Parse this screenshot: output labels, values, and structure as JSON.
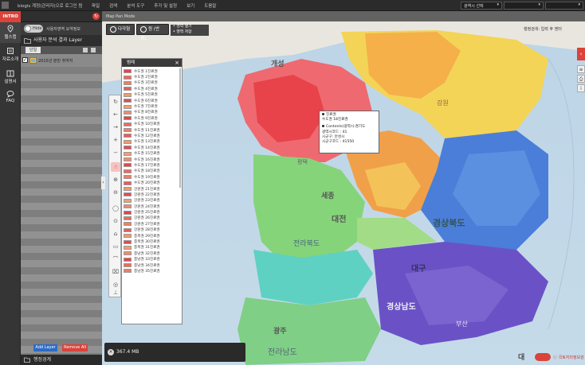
{
  "topbar": {
    "login_text": "biogis 계정(관리자)으로 로그인 됨",
    "menu": [
      "파일",
      "검색",
      "분석 도구",
      "추가 및 설정",
      "보기",
      "도움말"
    ],
    "region_select": "광역시 선택",
    "select2": "",
    "select3": ""
  },
  "intro_label": "INTRO",
  "refresh_glyph": "↻",
  "nav": [
    {
      "label": "웹스맵",
      "icon": "map-pin-icon"
    },
    {
      "label": "자료소개",
      "icon": "book-icon"
    },
    {
      "label": "설명서",
      "icon": "manual-icon"
    },
    {
      "label": "FAQ",
      "icon": "speech-bubble-icon"
    }
  ],
  "panel": {
    "toggle_label": "Hide",
    "hint": "사용자영역 요약정보",
    "layer_title": "사용자 분석 결과 Layer",
    "tab_single": "단일",
    "layer_name": "2015년 분만 취약지",
    "layer_checked": "✓",
    "add_button": "Add Layer",
    "remove_button": "Remove All",
    "footer": "행정경계"
  },
  "map": {
    "mode_label": "Map Pan Mode",
    "tool_pan": "다각형",
    "tool_circle": "원 (반경)",
    "tool_area1": "• 영역 열기",
    "tool_area2": "• 영역 저장",
    "right_label": "행정검색: 입력 후 엔터",
    "memory": "367.4 MB",
    "memory_icon": "×",
    "collapse_glyph": "‹",
    "logo": "대",
    "copyright": "ⓒ 국토지리정보원",
    "right_tab_glyph": "‹",
    "city_labels": [
      {
        "text": "개성"
      },
      {
        "text": "평택"
      },
      {
        "text": "세종"
      },
      {
        "text": "대전"
      },
      {
        "text": "경상북도"
      },
      {
        "text": "전라북도"
      },
      {
        "text": "대구"
      },
      {
        "text": "광주"
      },
      {
        "text": "전라남도"
      },
      {
        "text": "경상남도"
      },
      {
        "text": "부산"
      },
      {
        "text": "강원"
      }
    ],
    "colors": {
      "high": "#e8424a",
      "orange": "#f4a23c",
      "yellow": "#f1dc57",
      "green": "#86d47a",
      "teal": "#5fd1c2",
      "blue": "#4a7ed8",
      "purple": "#6a52c6",
      "sea": "#bcd4e6"
    }
  },
  "vtools": [
    "↻",
    "←",
    "→",
    "+",
    "−",
    "☝",
    "⊕",
    "⊖",
    "◯",
    "⊙",
    "⌂",
    "▭",
    "⌒",
    "⌧",
    "◎",
    "⊥"
  ],
  "legend": {
    "title": "범례",
    "close": "×",
    "items": [
      {
        "label": "수도권 1진료권",
        "color": "#e8424a"
      },
      {
        "label": "수도권 2진료권",
        "color": "#ee6a58"
      },
      {
        "label": "수도권 3진료권",
        "color": "#f07e62"
      },
      {
        "label": "수도권 4진료권",
        "color": "#ec5a5a"
      },
      {
        "label": "수도권 5진료권",
        "color": "#f29a68"
      },
      {
        "label": "수도권 6진료권",
        "color": "#e24a56"
      },
      {
        "label": "수도권 7진료권",
        "color": "#f0a070"
      },
      {
        "label": "수도권 8진료권",
        "color": "#f48a6c"
      },
      {
        "label": "수도권 9진료권",
        "color": "#e8424a"
      },
      {
        "label": "수도권 10진료권",
        "color": "#ee6a58"
      },
      {
        "label": "수도권 11진료권",
        "color": "#f07e62"
      },
      {
        "label": "수도권 12진료권",
        "color": "#ec5a5a"
      },
      {
        "label": "수도권 13진료권",
        "color": "#f29a68"
      },
      {
        "label": "수도권 14진료권",
        "color": "#e24a56"
      },
      {
        "label": "수도권 15진료권",
        "color": "#f0a070"
      },
      {
        "label": "수도권 16진료권",
        "color": "#f48a6c"
      },
      {
        "label": "수도권 17진료권",
        "color": "#e8424a"
      },
      {
        "label": "수도권 18진료권",
        "color": "#ee6a58"
      },
      {
        "label": "수도권 19진료권",
        "color": "#f07e62"
      },
      {
        "label": "수도권 20진료권",
        "color": "#ec5a5a"
      },
      {
        "label": "강원권 21진료권",
        "color": "#f29a68"
      },
      {
        "label": "강원권 22진료권",
        "color": "#e24a56"
      },
      {
        "label": "강원권 23진료권",
        "color": "#f0a070"
      },
      {
        "label": "강원권 24진료권",
        "color": "#f48a6c"
      },
      {
        "label": "강원권 25진료권",
        "color": "#e8424a"
      },
      {
        "label": "강원권 26진료권",
        "color": "#ee6a58"
      },
      {
        "label": "강원권 27진료권",
        "color": "#f07e62"
      },
      {
        "label": "강원권 28진료권",
        "color": "#ec5a5a"
      },
      {
        "label": "충북권 29진료권",
        "color": "#f29a68"
      },
      {
        "label": "충북권 30진료권",
        "color": "#e24a56"
      },
      {
        "label": "충북권 31진료권",
        "color": "#f0a070"
      },
      {
        "label": "충남권 32진료권",
        "color": "#f48a6c"
      },
      {
        "label": "충남권 33진료권",
        "color": "#e8424a"
      },
      {
        "label": "충남권 34진료권",
        "color": "#ee6a58"
      },
      {
        "label": "충남권 35진료권",
        "color": "#f07e62"
      }
    ]
  },
  "tooltip": {
    "line1": "진료권",
    "line2": "수도권 18진료권",
    "line3": "Contents(광역시:경기도",
    "line4": "광역시코드 : 41",
    "line5": "시군구: 안성시",
    "line6": "시군구코드 : 41550"
  }
}
